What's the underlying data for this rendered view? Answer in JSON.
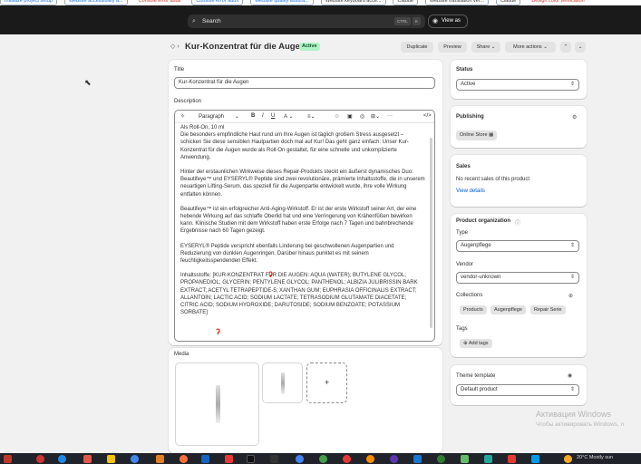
{
  "bookmarks": [
    "Initialize project setup",
    "Website accessibility a...",
    "Console error audit",
    "Console error audit",
    "Website quality assura...",
    "Website keyboard acce...",
    "Claude",
    "Website translation ver...",
    "Claude",
    "Design color verification"
  ],
  "topbar": {
    "search_placeholder": "Search",
    "kbd_ctrl": "CTRL",
    "kbd_k": "K",
    "view_as": "View as"
  },
  "header": {
    "title": "Kur-Konzentrat für die Augen",
    "status_badge": "Active",
    "duplicate": "Duplicate",
    "preview": "Preview",
    "share": "Share",
    "more_actions": "More actions"
  },
  "product": {
    "title_label": "Title",
    "title_value": "Kur-Konzentrat für die Augen",
    "description_label": "Description",
    "toolbar": {
      "paragraph": "Paragraph"
    },
    "description": [
      "Als Roll-On, 10 ml",
      "Die besonders empfindliche Haut rund um Ihre Augen ist täglich großem Stress ausgesetzt – schicken Sie diese sensiblen Hautpartien doch mal auf Kur! Das geht ganz einfach: Unser Kur-Konzentrat für die Augen wurde als Roll-On gestaltet, für eine schnelle und unkomplizierte Anwendung.",
      "Hinter der erstaunlichen Wirkweise dieses Repair-Produkts steckt ein äußerst dynamisches Duo: Beautifeye™ und EYSERYL® Peptide sind zwei revolutionäre, prämierte Inhaltsstoffe, die in unserem neuartigen Lifting-Serum, das speziell für die Augenpartie entwickelt wurde, ihre volle Wirkung entfalten können.",
      "Beautifeye™ ist ein erfolgreicher Anti-Aging-Wirkstoff. Er ist der erste Wirkstoff seiner Art, der eine hebende Wirkung auf das schlaffe Oberlid hat und eine Verringerung von Krähenfüßen bewirken kann. Klinische Studien mit dem Wirkstoff haben erste Erfolge nach 7 Tagen und bahnbrechende Ergebnisse nach 60 Tagen gezeigt.",
      "EYSERYL® Peptide verspricht ebenfalls Linderung bei geschwollenen Augenpartien und Reduzierung von dunklen Augenringen. Darüber hinaus punktet es mit seinem feuchtigkeitsspendenden Effekt.",
      "Inhaltsstoffe: [KUR-KONZENTRAT FÜR DIE AUGEN: AQUA (WATER); BUTYLENE GLYCOL; PROPANEDIOL; GLYCERIN; PENTYLENE GLYCOL; PANTHENOL; ALBIZIA JULIBRISSIN BARK EXTRACT; ACETYL TETRAPEPTIDE-5; XANTHAN GUM; EUPHRASIA OFFICINALIS EXTRACT; ALLANTOIN; LACTIC ACID; SODIUM LACTATE; TETRASODIUM GLUTAMATE DIACETATE; CITRIC ACID; SODIUM HYDROXIDE; DARUTOSIDE; SODIUM BENZOATE; POTASSIUM SORBATE]"
    ],
    "media_label": "Media",
    "media_add": "+"
  },
  "sidebar": {
    "status_label": "Status",
    "status_value": "Active",
    "publishing_label": "Publishing",
    "publishing_channel": "Online Store",
    "sales_label": "Sales",
    "sales_text": "No recent sales of this product",
    "view_details": "View details",
    "org_label": "Product organization",
    "type_label": "Type",
    "type_value": "Augenpflege",
    "vendor_label": "Vendor",
    "vendor_value": "vendor-unknown",
    "collections_label": "Collections",
    "collections": [
      "Products",
      "Augenpflege",
      "Repair Serie"
    ],
    "tags_label": "Tags",
    "add_tags": "Add tags",
    "theme_label": "Theme template",
    "theme_value": "Default product"
  },
  "watermark": {
    "line1": "Активация Windows",
    "line2": "Чтобы активировать Windows, п"
  },
  "tray": {
    "weather": "20°C  Mostly sun"
  },
  "colors": {
    "accent": "#005bd3",
    "active_badge": "#aff2c4",
    "topbar": "#1a1a1a"
  }
}
